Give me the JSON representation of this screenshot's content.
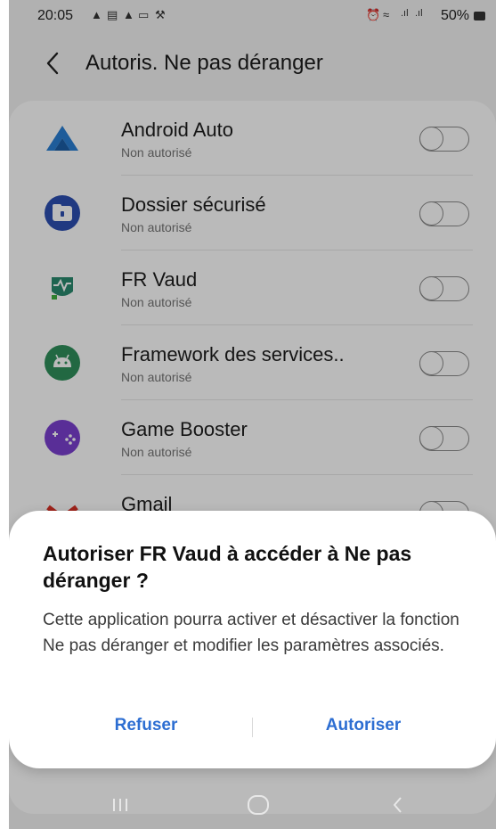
{
  "status_bar": {
    "time": "20:05",
    "battery": "50%"
  },
  "header": {
    "title": "Autoris. Ne pas déranger"
  },
  "apps": [
    {
      "name": "Android Auto",
      "status": "Non autorisé",
      "icon": "android-auto-icon",
      "enabled": false
    },
    {
      "name": "Dossier sécurisé",
      "status": "Non autorisé",
      "icon": "secure-folder-icon",
      "enabled": false
    },
    {
      "name": "FR Vaud",
      "status": "Non autorisé",
      "icon": "fr-vaud-icon",
      "enabled": false
    },
    {
      "name": "Framework des services..",
      "status": "Non autorisé",
      "icon": "android-framework-icon",
      "enabled": false
    },
    {
      "name": "Game Booster",
      "status": "Non autorisé",
      "icon": "game-booster-icon",
      "enabled": false
    },
    {
      "name": "Gmail",
      "status": "",
      "icon": "gmail-icon",
      "enabled": false
    }
  ],
  "dialog": {
    "title": "Autoriser FR Vaud à accéder à Ne pas déranger ?",
    "message": "Cette application pourra activer et désactiver la fonction Ne pas déranger et modifier les paramètres associés.",
    "refuse_label": "Refuser",
    "allow_label": "Autoriser"
  },
  "colors": {
    "accent": "#2d6ed2",
    "overlay": "rgba(0,0,0,0.27)"
  }
}
